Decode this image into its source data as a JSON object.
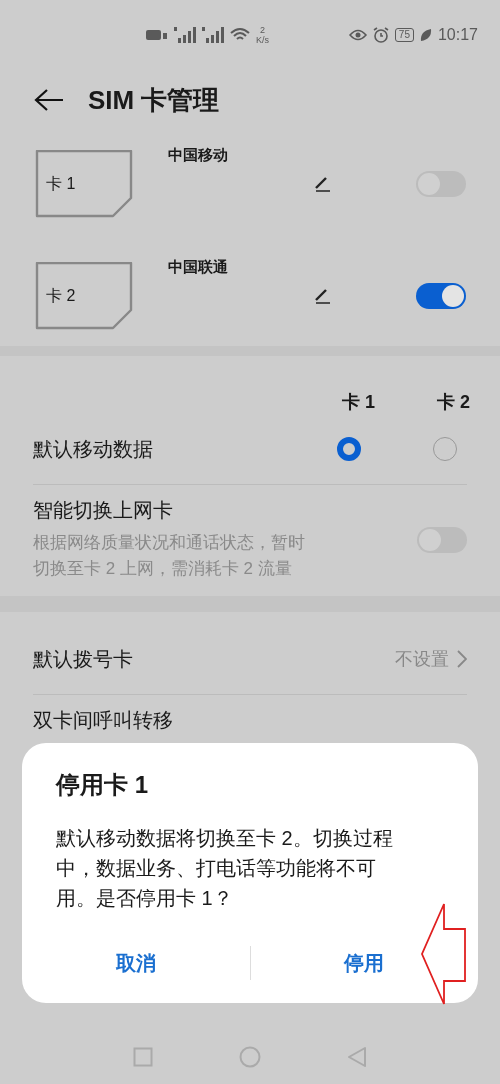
{
  "status_bar": {
    "speed_value": "2",
    "speed_unit": "K/s",
    "battery": "75",
    "time": "10:17"
  },
  "header": {
    "title": "SIM 卡管理"
  },
  "sim_cards": [
    {
      "slot_label": "卡 1",
      "carrier": "中国移动",
      "on": false
    },
    {
      "slot_label": "卡 2",
      "carrier": "中国联通",
      "on": true
    }
  ],
  "sim_columns": [
    "卡 1",
    "卡 2"
  ],
  "default_data": {
    "label": "默认移动数据",
    "options": [
      {
        "selected": true
      },
      {
        "selected": false
      }
    ]
  },
  "smart_switch": {
    "label": "智能切换上网卡",
    "description": "根据网络质量状况和通话状态，暂时切换至卡 2 上网，需消耗卡 2 流量",
    "on": false
  },
  "default_dial": {
    "label": "默认拨号卡",
    "value": "不设置"
  },
  "call_forward": {
    "label": "双卡间呼叫转移"
  },
  "dialog": {
    "title": "停用卡 1",
    "message": "默认移动数据将切换至卡 2。切换过程中，数据业务、打电话等功能将不可用。是否停用卡 1？",
    "buttons": [
      "取消",
      "停用"
    ]
  }
}
